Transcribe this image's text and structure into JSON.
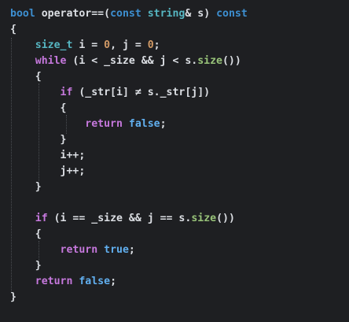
{
  "theme": {
    "background": "#1e1f22",
    "plain": "#dcdfe4",
    "keyword": "#3d8fd1",
    "control": "#c678dd",
    "type": "#56b6c2",
    "number": "#d19a66",
    "function": "#98c379",
    "boolean": "#61afef",
    "indent_guide": "#4a4d52"
  },
  "code": {
    "lines": [
      [
        [
          "kw",
          "bool"
        ],
        [
          "p",
          " operator"
        ],
        [
          "op",
          "=="
        ],
        [
          "p",
          "("
        ],
        [
          "kw",
          "const"
        ],
        [
          "p",
          " "
        ],
        [
          "type",
          "string"
        ],
        [
          "p",
          "& s) "
        ],
        [
          "kw",
          "const"
        ]
      ],
      [
        [
          "p",
          "{"
        ]
      ],
      [
        [
          "p",
          "    "
        ],
        [
          "type",
          "size_t"
        ],
        [
          "p",
          " i = "
        ],
        [
          "num",
          "0"
        ],
        [
          "p",
          ", j = "
        ],
        [
          "num",
          "0"
        ],
        [
          "p",
          ";"
        ]
      ],
      [
        [
          "p",
          "    "
        ],
        [
          "ctrl",
          "while"
        ],
        [
          "p",
          " (i < _size && j < s."
        ],
        [
          "fn",
          "size"
        ],
        [
          "p",
          "())"
        ]
      ],
      [
        [
          "p",
          "    {"
        ]
      ],
      [
        [
          "p",
          "        "
        ],
        [
          "ctrl",
          "if"
        ],
        [
          "p",
          " (_str[i] "
        ],
        [
          "op",
          "≠"
        ],
        [
          "p",
          " s._str[j])"
        ]
      ],
      [
        [
          "p",
          "        {"
        ]
      ],
      [
        [
          "p",
          "            "
        ],
        [
          "ctrl",
          "return"
        ],
        [
          "p",
          " "
        ],
        [
          "bool",
          "false"
        ],
        [
          "p",
          ";"
        ]
      ],
      [
        [
          "p",
          "        }"
        ]
      ],
      [
        [
          "p",
          "        i++;"
        ]
      ],
      [
        [
          "p",
          "        j++;"
        ]
      ],
      [
        [
          "p",
          "    }"
        ]
      ],
      [
        [
          "p",
          ""
        ]
      ],
      [
        [
          "p",
          "    "
        ],
        [
          "ctrl",
          "if"
        ],
        [
          "p",
          " (i "
        ],
        [
          "op",
          "=="
        ],
        [
          "p",
          " _size && j "
        ],
        [
          "op",
          "=="
        ],
        [
          "p",
          " s."
        ],
        [
          "fn",
          "size"
        ],
        [
          "p",
          "())"
        ]
      ],
      [
        [
          "p",
          "    {"
        ]
      ],
      [
        [
          "p",
          "        "
        ],
        [
          "ctrl",
          "return"
        ],
        [
          "p",
          " "
        ],
        [
          "bool",
          "true"
        ],
        [
          "p",
          ";"
        ]
      ],
      [
        [
          "p",
          "    }"
        ]
      ],
      [
        [
          "p",
          "    "
        ],
        [
          "ctrl",
          "return"
        ],
        [
          "p",
          " "
        ],
        [
          "bool",
          "false"
        ],
        [
          "p",
          ";"
        ]
      ],
      [
        [
          "p",
          "}"
        ]
      ]
    ]
  }
}
